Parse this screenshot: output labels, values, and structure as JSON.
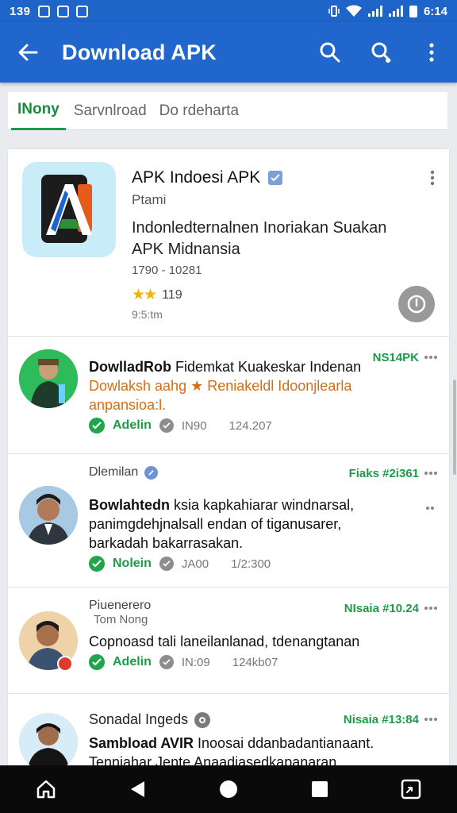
{
  "status_bar": {
    "time_left": "139",
    "time_right": "6:14"
  },
  "app_bar": {
    "title": "Download APK"
  },
  "tabs": [
    {
      "label": "INony",
      "active": true
    },
    {
      "label": "Sarvnlroad",
      "active": false
    },
    {
      "label": "Do rdeharta",
      "active": false
    }
  ],
  "app": {
    "name": "APK Indoesi APK",
    "developer": "Ptami",
    "description_line1": "Indonledternalnen Inoriakan Suakan",
    "description_line2": "APK Midnansia",
    "meta": "1790 - 10281",
    "rating": "119",
    "size": "9:5:tm"
  },
  "posts": [
    {
      "line1_bold": "DowlladRob",
      "line1_rest": " Fidemkat Kuakeskar Indenan",
      "line2": "Dowlaksh aahg ★ Reniakeldl Idoonjlearla",
      "line3": "anpansioa:l.",
      "price": "NS14PK",
      "status": "Adelin",
      "meta_a": "IN90",
      "meta_b": "124.207"
    },
    {
      "author": "Dlemilan",
      "line1_bold": "Bowlahtedn",
      "line1_rest": " ksia kapkahiarar windnarsal,",
      "line2": "panimgdehjnalsall endan of tiganusarer,",
      "line3": "barkadah bakarrasakan.",
      "price": "Fiaks #2i361",
      "status": "Nolein",
      "meta_a": "JA00",
      "meta_b": "1/2:300"
    },
    {
      "author": "Piuenerero",
      "author_sub": "Tom Nong",
      "line1": "Copnoasd tali laneilanlanad, tdenangtanan",
      "price": "NIsaia #10.24",
      "status": "Adelin",
      "meta_a": "IN:09",
      "meta_b": "124kb07"
    },
    {
      "author": "Sonadal Ingeds",
      "line1_bold": "Sambload AVIR",
      "line1_rest": " Inoosai ddanbadantianaant.",
      "line2": "Tenniahar Jente Anaadiasedkapanaran",
      "price": "Nisaia #13:84"
    }
  ],
  "colors": {
    "primary": "#2066cd",
    "accent_green": "#1f9a49",
    "orange_text": "#d86d10",
    "star": "#f0b400"
  },
  "icons": [
    "back-arrow-icon",
    "search-icon",
    "share-search-icon",
    "more-vert-icon",
    "verified-icon",
    "download-icon",
    "check-icon",
    "home-icon",
    "back-icon",
    "circle-home-icon",
    "recents-icon",
    "screenshot-icon"
  ]
}
